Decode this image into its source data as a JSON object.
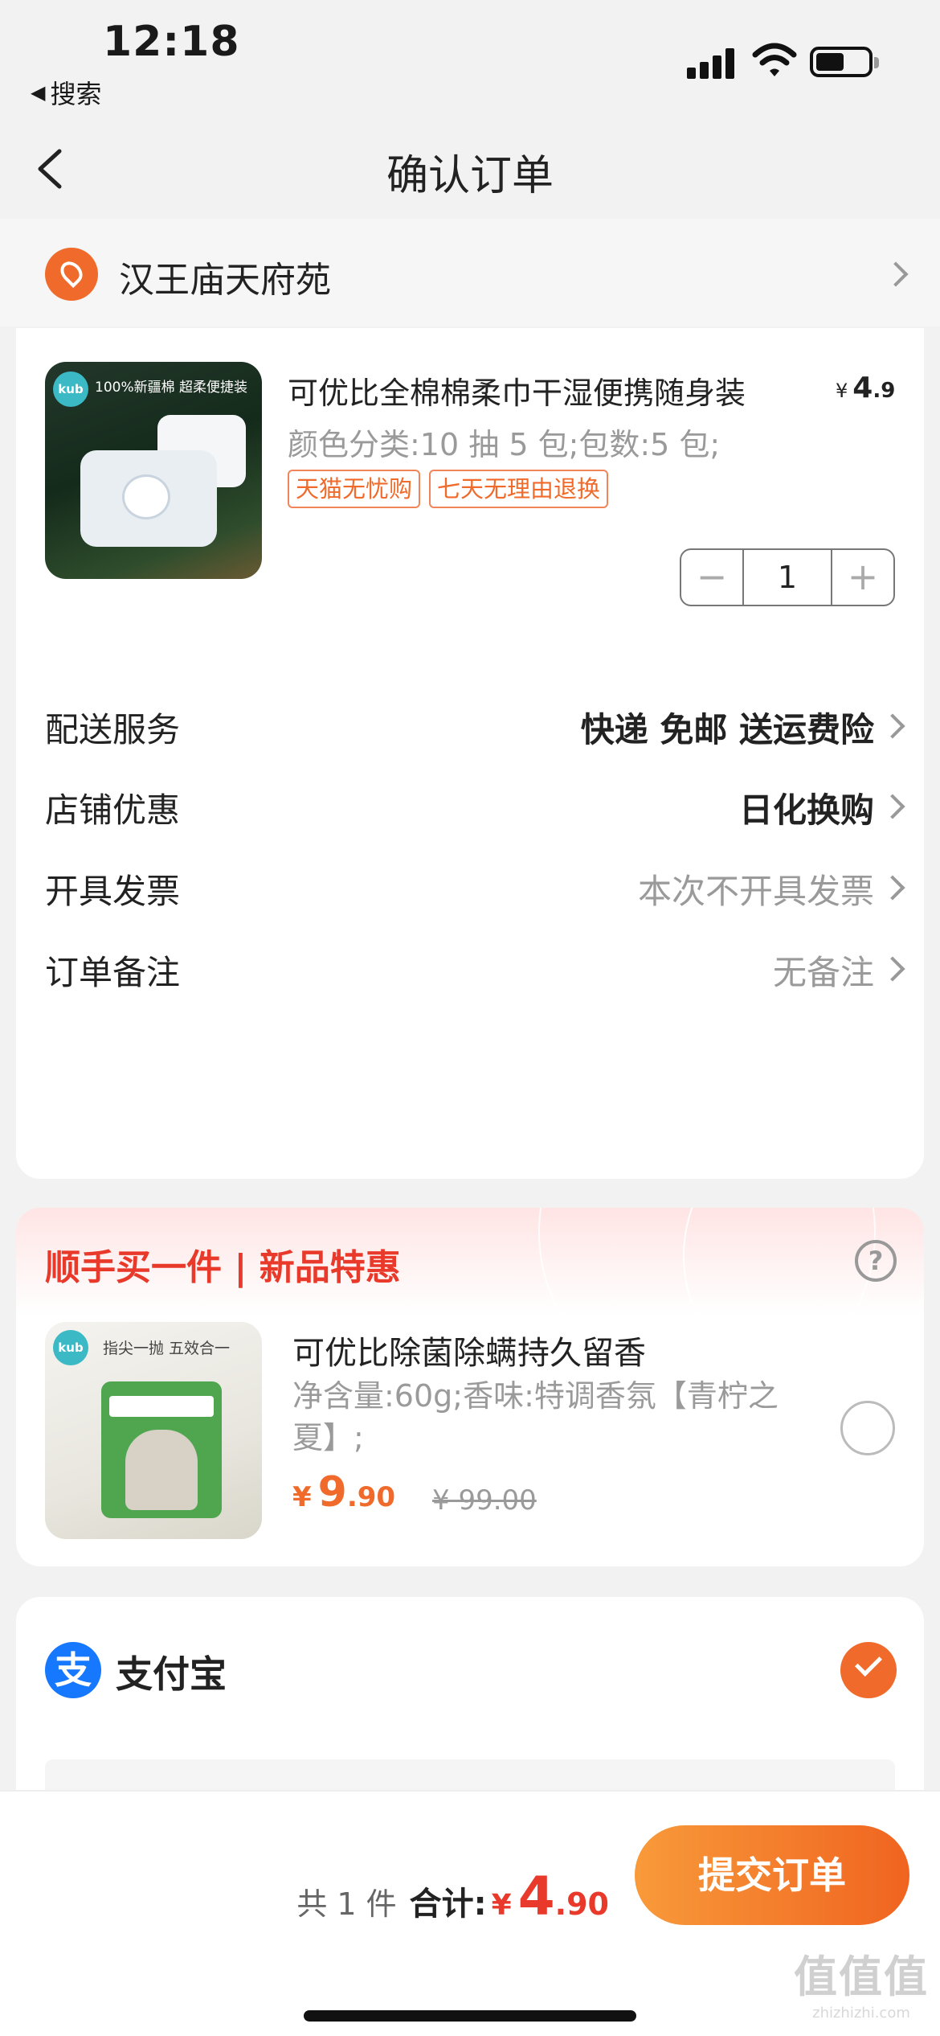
{
  "status_bar": {
    "time": "12:18",
    "back_app": "搜索"
  },
  "nav": {
    "title": "确认订单"
  },
  "address": {
    "text": "汉王庙天府苑"
  },
  "product": {
    "title": "可优比全棉棉柔巾干湿便携随身装",
    "price_symbol": "¥",
    "price_int": "4",
    "price_dec": ".9",
    "spec": "颜色分类:10 抽 5 包;包数:5 包;",
    "tags": [
      "天猫无忧购",
      "七天无理由退换"
    ],
    "quantity": "1",
    "image": {
      "logo": "kub",
      "banner": "100%新疆棉 超柔便捷装"
    }
  },
  "rows": [
    {
      "label": "配送服务",
      "value": "快递 免邮 送运费险"
    },
    {
      "label": "店铺优惠",
      "value": "日化换购"
    },
    {
      "label": "开具发票",
      "value": "本次不开具发票"
    },
    {
      "label": "订单备注",
      "value": "无备注"
    }
  ],
  "upsell": {
    "title": "顺手买一件 | 新品特惠",
    "product_title": "可优比除菌除螨持久留香",
    "spec": "净含量:60g;香味:特调香氛【青柠之夏】;",
    "price_symbol": "¥",
    "price_int": "9",
    "price_dec": ".90",
    "old_price": "¥ 99.00",
    "image": {
      "logo": "kub",
      "banner": "指尖一抛 五效合一"
    }
  },
  "payment": {
    "method": "支付宝",
    "icon_char": "支"
  },
  "bottom_bar": {
    "count": "共 1 件",
    "total_label": "合计:",
    "total_symbol": "¥",
    "total_int": "4",
    "total_dec": ".90",
    "submit_label": "提交订单"
  },
  "watermark": {
    "big": "值值值",
    "small": "zhizhizhi.com"
  },
  "colors": {
    "accent": "#f06b2b",
    "red": "#e8392a",
    "alipay_blue": "#1677ff",
    "background": "#f2f2f2"
  }
}
